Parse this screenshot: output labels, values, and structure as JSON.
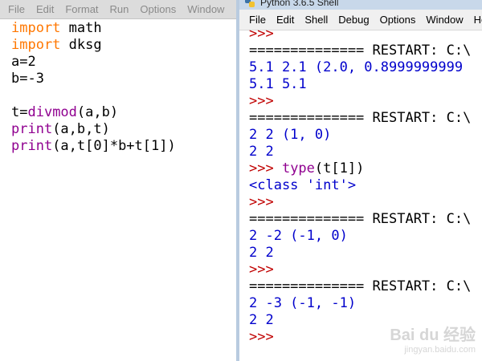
{
  "editor": {
    "menu": [
      "File",
      "Edit",
      "Format",
      "Run",
      "Options",
      "Window"
    ],
    "code": [
      [
        {
          "t": "import",
          "c": "kw"
        },
        {
          "t": " math",
          "c": ""
        }
      ],
      [
        {
          "t": "import",
          "c": "kw"
        },
        {
          "t": " dksg",
          "c": ""
        }
      ],
      [
        {
          "t": "a=2",
          "c": ""
        }
      ],
      [
        {
          "t": "b=-3",
          "c": ""
        }
      ],
      [],
      [
        {
          "t": "t=",
          "c": ""
        },
        {
          "t": "divmod",
          "c": "bi"
        },
        {
          "t": "(a,b)",
          "c": ""
        }
      ],
      [
        {
          "t": "print",
          "c": "bi"
        },
        {
          "t": "(a,b,t)",
          "c": ""
        }
      ],
      [
        {
          "t": "print",
          "c": "bi"
        },
        {
          "t": "(a,t[0]*b+t[1])",
          "c": ""
        }
      ]
    ]
  },
  "shell": {
    "title": "Python 3.6.5 Shell",
    "menu": [
      "File",
      "Edit",
      "Shell",
      "Debug",
      "Options",
      "Window",
      "Help"
    ],
    "output": [
      [
        {
          "t": ">>>",
          "c": "prompt"
        }
      ],
      [
        {
          "t": "============== RESTART: C:\\",
          "c": "restart"
        }
      ],
      [
        {
          "t": "5.1 2.1 (2.0, 0.8999999999",
          "c": "stdout"
        }
      ],
      [
        {
          "t": "5.1 5.1",
          "c": "stdout"
        }
      ],
      [
        {
          "t": ">>>",
          "c": "prompt"
        }
      ],
      [
        {
          "t": "============== RESTART: C:\\",
          "c": "restart"
        }
      ],
      [
        {
          "t": "2 2 (1, 0)",
          "c": "stdout"
        }
      ],
      [
        {
          "t": "2 2",
          "c": "stdout"
        }
      ],
      [
        {
          "t": ">>> ",
          "c": "prompt"
        },
        {
          "t": "type",
          "c": "input-kw"
        },
        {
          "t": "(t[1])",
          "c": "input"
        }
      ],
      [
        {
          "t": "<class 'int'>",
          "c": "res"
        }
      ],
      [
        {
          "t": ">>>",
          "c": "prompt"
        }
      ],
      [
        {
          "t": "============== RESTART: C:\\",
          "c": "restart"
        }
      ],
      [
        {
          "t": "2 -2 (-1, 0)",
          "c": "stdout"
        }
      ],
      [
        {
          "t": "2 2",
          "c": "stdout"
        }
      ],
      [
        {
          "t": ">>>",
          "c": "prompt"
        }
      ],
      [
        {
          "t": "============== RESTART: C:\\",
          "c": "restart"
        }
      ],
      [
        {
          "t": "2 -3 (-1, -1)",
          "c": "stdout"
        }
      ],
      [
        {
          "t": "2 2",
          "c": "stdout"
        }
      ],
      [
        {
          "t": ">>>",
          "c": "prompt"
        }
      ]
    ]
  },
  "watermark": {
    "main": "Bai du 经验",
    "sub": "jingyan.baidu.com"
  },
  "icons": {
    "app": "python-idle-icon"
  },
  "colors": {
    "prompt": "#c00000",
    "stdout": "#0000cc",
    "keyword": "#ff7700",
    "builtin": "#900090"
  }
}
